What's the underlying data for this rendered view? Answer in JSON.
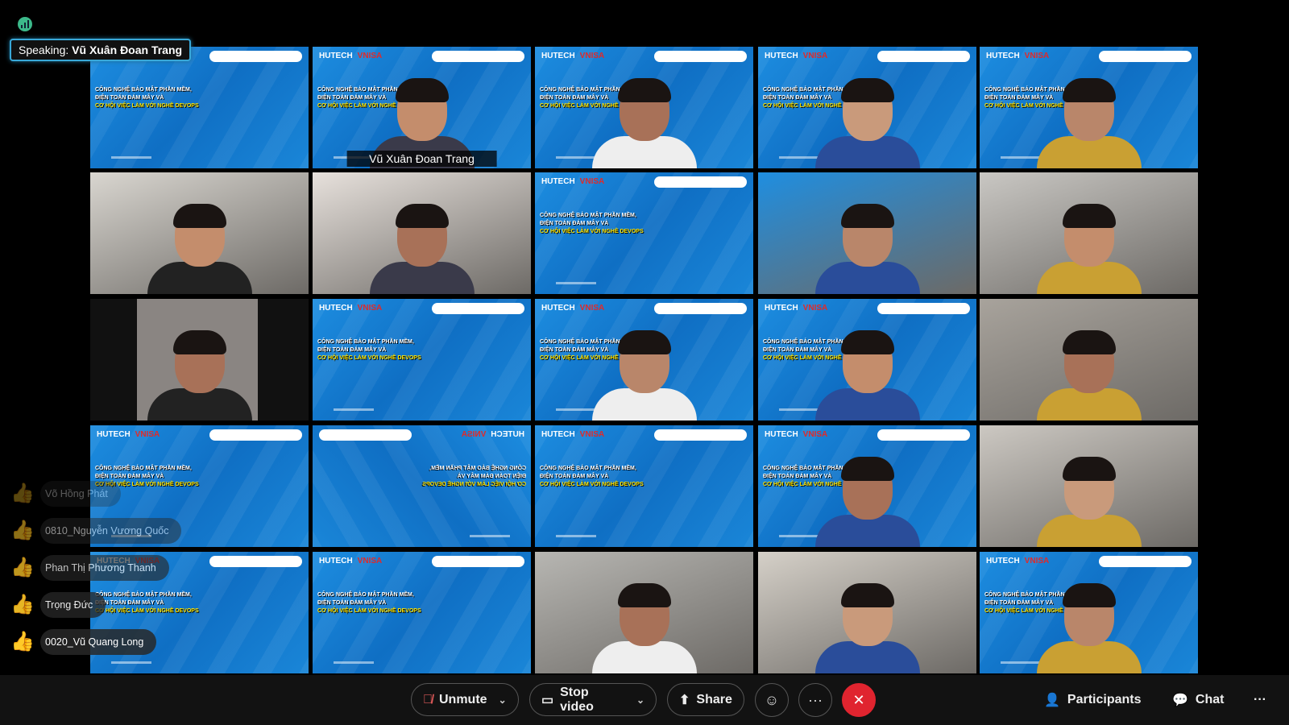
{
  "speaking": {
    "prefix": "Speaking:",
    "name": "Vũ Xuân Đoan Trang"
  },
  "slide": {
    "logo": "HUTECH",
    "logo2": "VNISA",
    "line1": "CÔNG NGHỆ BẢO MẬT PHẦN MỀM,",
    "line2": "ĐIỆN TOÁN ĐÁM MÂY VÀ",
    "line3": "CƠ HỘI VIỆC LÀM VỚI NGHỀ DEVOPS"
  },
  "tiles": [
    {
      "type": "slide"
    },
    {
      "type": "slide",
      "person": true,
      "label": "Vũ Xuân Đoan Trang",
      "active": true
    },
    {
      "type": "slide",
      "person": true
    },
    {
      "type": "slide",
      "person": true
    },
    {
      "type": "slide",
      "person": true
    },
    {
      "type": "cam",
      "bg": "#d9d6d0"
    },
    {
      "type": "cam",
      "bg": "#e7e1dc"
    },
    {
      "type": "slide"
    },
    {
      "type": "cam",
      "bg": "#1f8ee0",
      "person": true
    },
    {
      "type": "cam",
      "bg": "#c9c7c3"
    },
    {
      "type": "cam",
      "bg": "#111",
      "person": true
    },
    {
      "type": "slide"
    },
    {
      "type": "slide",
      "person": true
    },
    {
      "type": "slide",
      "person": true
    },
    {
      "type": "cam",
      "bg": "#a8a39c"
    },
    {
      "type": "slide"
    },
    {
      "type": "slide",
      "mirror": true
    },
    {
      "type": "slide"
    },
    {
      "type": "slide",
      "person": true
    },
    {
      "type": "cam",
      "bg": "#ccc8c2"
    },
    {
      "type": "slide"
    },
    {
      "type": "slide"
    },
    {
      "type": "cam",
      "bg": "#b7b6b2"
    },
    {
      "type": "cam",
      "bg": "#d5d0c8"
    },
    {
      "type": "slide",
      "person": true
    }
  ],
  "reactions": [
    {
      "icon": "thumbs-up",
      "name": "Võ Hồng Phát",
      "opacity": 0.35
    },
    {
      "icon": "thumbs-up",
      "name": "0810_Nguyễn Vương Quốc",
      "opacity": 0.55
    },
    {
      "icon": "thumbs-up",
      "name": "Phan Thị Phương Thanh",
      "opacity": 0.75
    },
    {
      "icon": "thumbs-up",
      "name": "Trọng Đức",
      "opacity": 0.9
    },
    {
      "icon": "thumbs-up",
      "name": "0020_Vũ Quang Long",
      "opacity": 1
    }
  ],
  "toolbar": {
    "unmute": "Unmute",
    "stop_video": "Stop video",
    "share": "Share",
    "more": "···",
    "participants": "Participants",
    "chat": "Chat",
    "overflow": "···"
  },
  "colors": {
    "accent": "#2fb4ef",
    "leave": "#e0242f",
    "muted_icon": "#e05a5a"
  }
}
